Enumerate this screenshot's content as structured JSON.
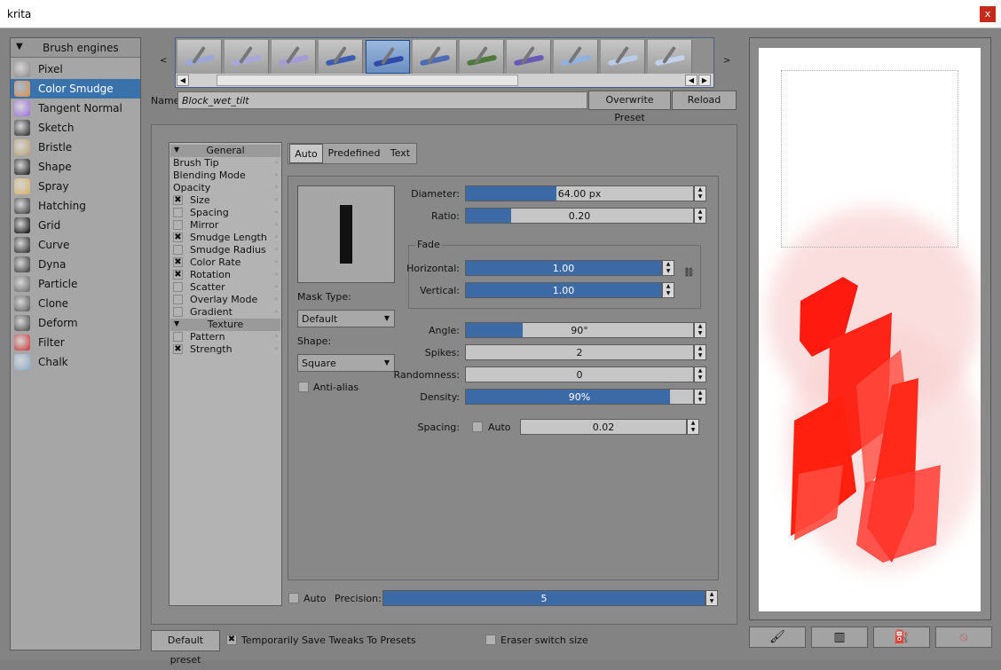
{
  "window": {
    "title": "krita",
    "close": "x"
  },
  "engines": {
    "header": "Brush engines",
    "items": [
      {
        "label": "Pixel",
        "icon": "pixel-brush-icon",
        "color": "#888888"
      },
      {
        "label": "Color Smudge",
        "icon": "color-smudge-icon",
        "color": "#e08a3c",
        "selected": true
      },
      {
        "label": "Tangent Normal",
        "icon": "tangent-normal-icon",
        "color": "#9b6be0"
      },
      {
        "label": "Sketch",
        "icon": "sketch-icon",
        "color": "#222222"
      },
      {
        "label": "Bristle",
        "icon": "bristle-icon",
        "color": "#b8a070"
      },
      {
        "label": "Shape",
        "icon": "shape-icon",
        "color": "#111111"
      },
      {
        "label": "Spray",
        "icon": "spray-icon",
        "color": "#d8b060"
      },
      {
        "label": "Hatching",
        "icon": "hatching-icon",
        "color": "#333333"
      },
      {
        "label": "Grid",
        "icon": "grid-icon",
        "color": "#000000"
      },
      {
        "label": "Curve",
        "icon": "curve-icon",
        "color": "#222222"
      },
      {
        "label": "Dyna",
        "icon": "dyna-icon",
        "color": "#333333"
      },
      {
        "label": "Particle",
        "icon": "particle-icon",
        "color": "#666666"
      },
      {
        "label": "Clone",
        "icon": "clone-icon",
        "color": "#555555"
      },
      {
        "label": "Deform",
        "icon": "deform-icon",
        "color": "#444444"
      },
      {
        "label": "Filter",
        "icon": "filter-icon",
        "color": "#cc3333"
      },
      {
        "label": "Chalk",
        "icon": "chalk-icon",
        "color": "#8aa8c8"
      }
    ]
  },
  "presets": {
    "nav_prev": "<",
    "nav_next": ">",
    "thumbnails": [
      {
        "stroke": "#9aa8d8"
      },
      {
        "stroke": "#a9a6da"
      },
      {
        "stroke": "#a49bd8"
      },
      {
        "stroke": "#3d5bb0"
      },
      {
        "stroke": "#2f4aa8",
        "selected": true
      },
      {
        "stroke": "#4e6bb8"
      },
      {
        "stroke": "#4f7a3a"
      },
      {
        "stroke": "#6a5ab8"
      },
      {
        "stroke": "#90b0e0"
      },
      {
        "stroke": "#b8cae8"
      },
      {
        "stroke": "#c2d0ea"
      }
    ],
    "name_label": "Name:",
    "name_value": "Block_wet_tilt",
    "overwrite": "Overwrite Preset",
    "reload": "Reload"
  },
  "options": {
    "general_header": "General",
    "texture_header": "Texture",
    "general": [
      {
        "label": "Brush Tip",
        "cb": null
      },
      {
        "label": "Blending Mode",
        "cb": null
      },
      {
        "label": "Opacity",
        "cb": null
      },
      {
        "label": "Size",
        "cb": true
      },
      {
        "label": "Spacing",
        "cb": false
      },
      {
        "label": "Mirror",
        "cb": false
      },
      {
        "label": "Smudge Length",
        "cb": true
      },
      {
        "label": "Smudge Radius",
        "cb": false
      },
      {
        "label": "Color Rate",
        "cb": true
      },
      {
        "label": "Rotation",
        "cb": true
      },
      {
        "label": "Scatter",
        "cb": false
      },
      {
        "label": "Overlay Mode",
        "cb": false
      },
      {
        "label": "Gradient",
        "cb": false
      }
    ],
    "texture": [
      {
        "label": "Pattern",
        "cb": false
      },
      {
        "label": "Strength",
        "cb": true
      }
    ]
  },
  "tabs": [
    "Auto",
    "Predefined",
    "Text"
  ],
  "tip": {
    "mask_type_label": "Mask Type:",
    "mask_type_value": "Default",
    "shape_label": "Shape:",
    "shape_value": "Square",
    "antialias_label": "Anti-alias",
    "fade_label": "Fade"
  },
  "sliders": {
    "diameter": {
      "label": "Diameter:",
      "value": "64.00 px",
      "fraction": 0.4
    },
    "ratio": {
      "label": "Ratio:",
      "value": "0.20",
      "fraction": 0.2
    },
    "horizontal": {
      "label": "Horizontal:",
      "value": "1.00",
      "fraction": 1.0
    },
    "vertical": {
      "label": "Vertical:",
      "value": "1.00",
      "fraction": 1.0
    },
    "angle": {
      "label": "Angle:",
      "value": "90°",
      "fraction": 0.25
    },
    "spikes": {
      "label": "Spikes:",
      "value": "2",
      "fraction": 0.0
    },
    "randomness": {
      "label": "Randomness:",
      "value": "0",
      "fraction": 0.0
    },
    "density": {
      "label": "Density:",
      "value": "90%",
      "fraction": 0.9
    },
    "spacing": {
      "label": "Spacing:",
      "auto": "Auto",
      "value": "0.02",
      "fraction": 0.0
    }
  },
  "precision": {
    "auto": "Auto",
    "label": "Precision:",
    "value": "5",
    "fraction": 1.0
  },
  "footer": {
    "default_preset": "Default preset",
    "temp_save": "Temporarily Save Tweaks To Presets",
    "eraser": "Eraser switch size"
  },
  "bottom_buttons": [
    {
      "icon": "brush-icon"
    },
    {
      "icon": "gradient-fill-icon"
    },
    {
      "icon": "paint-bucket-icon"
    },
    {
      "icon": "clear-canvas-icon"
    }
  ]
}
